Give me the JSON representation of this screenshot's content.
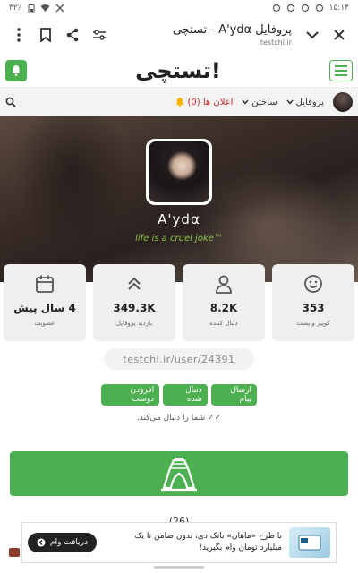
{
  "statusbar": {
    "time": "۱۵:۱۴",
    "battery": "۳۲٪"
  },
  "browser": {
    "page_title": "پروفایل A'ydα - تستچی",
    "url": "testchi.ir"
  },
  "site": {
    "logo": "تستچی!"
  },
  "nav": {
    "profile": "پروفایل",
    "build": "ساختن",
    "notifications": "اعلان ها (0)"
  },
  "profile": {
    "username": "A'ydα",
    "bio": "life is a cruel joke™"
  },
  "stats": [
    {
      "value": "353",
      "label": "کوییز و پست",
      "icon": "smiley-icon"
    },
    {
      "value": "8.2K",
      "label": "دنبال کننده",
      "icon": "person-icon"
    },
    {
      "value": "349.3K",
      "label": "بازدید پروفایل",
      "icon": "chevrons-up-icon"
    },
    {
      "value": "4 سال پیش",
      "label": "عضویت",
      "icon": "calendar-icon"
    }
  ],
  "profile_url": "testchi.ir/user/24391",
  "actions": {
    "message": "ارسال پیام",
    "following": "دنبال شده",
    "add_friend": "افزودن دوست"
  },
  "follows_note": "✓✓ شما را دنبال می‌کند.",
  "partial_heading": "(26)",
  "ad": {
    "line1": "با طرح «ماهان» بانک دی، بدون ضامن تا یک",
    "line2": "میلیارد تومان وام بگیرید!",
    "button": "دریافت وام"
  },
  "colors": {
    "accent": "#4caf50",
    "danger": "#c62828"
  }
}
